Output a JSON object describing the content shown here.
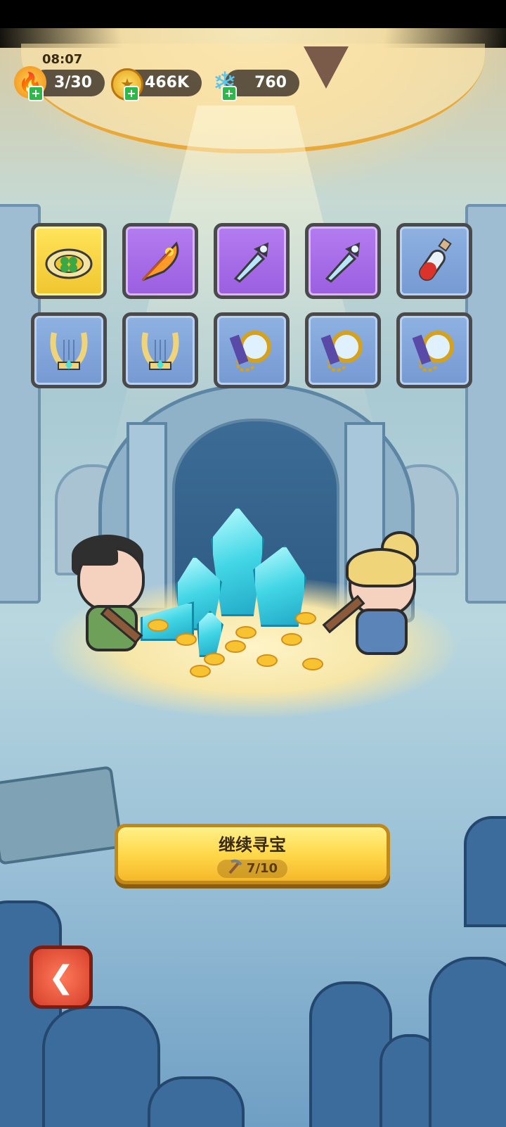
{
  "hud": {
    "clock": "08:07",
    "energy": {
      "value": "3/30",
      "icon": "flame-icon"
    },
    "gold": {
      "value": "466K",
      "icon": "gold-coin-icon"
    },
    "gems": {
      "value": "760",
      "icon": "crystal-icon"
    }
  },
  "rewards": {
    "row1": [
      {
        "name": "clover-ring",
        "rarity": "gold"
      },
      {
        "name": "phoenix-feather",
        "rarity": "purple"
      },
      {
        "name": "ice-dagger",
        "rarity": "purple"
      },
      {
        "name": "ice-dagger",
        "rarity": "purple"
      },
      {
        "name": "red-potion",
        "rarity": "blue"
      }
    ],
    "row2": [
      {
        "name": "golden-lyre",
        "rarity": "blue"
      },
      {
        "name": "golden-lyre",
        "rarity": "blue"
      },
      {
        "name": "pocket-watch",
        "rarity": "blue"
      },
      {
        "name": "pocket-watch",
        "rarity": "blue"
      },
      {
        "name": "pocket-watch",
        "rarity": "blue"
      }
    ]
  },
  "action": {
    "label": "继续寻宝",
    "pickaxes": "7/10",
    "icon": "pickaxe-icon"
  },
  "back": {
    "icon": "back-arrow-icon"
  },
  "colors": {
    "accent": "#ffd84a",
    "gold_rarity": "#f0c530",
    "purple_rarity": "#9a5ee0",
    "blue_rarity": "#7599d2"
  }
}
